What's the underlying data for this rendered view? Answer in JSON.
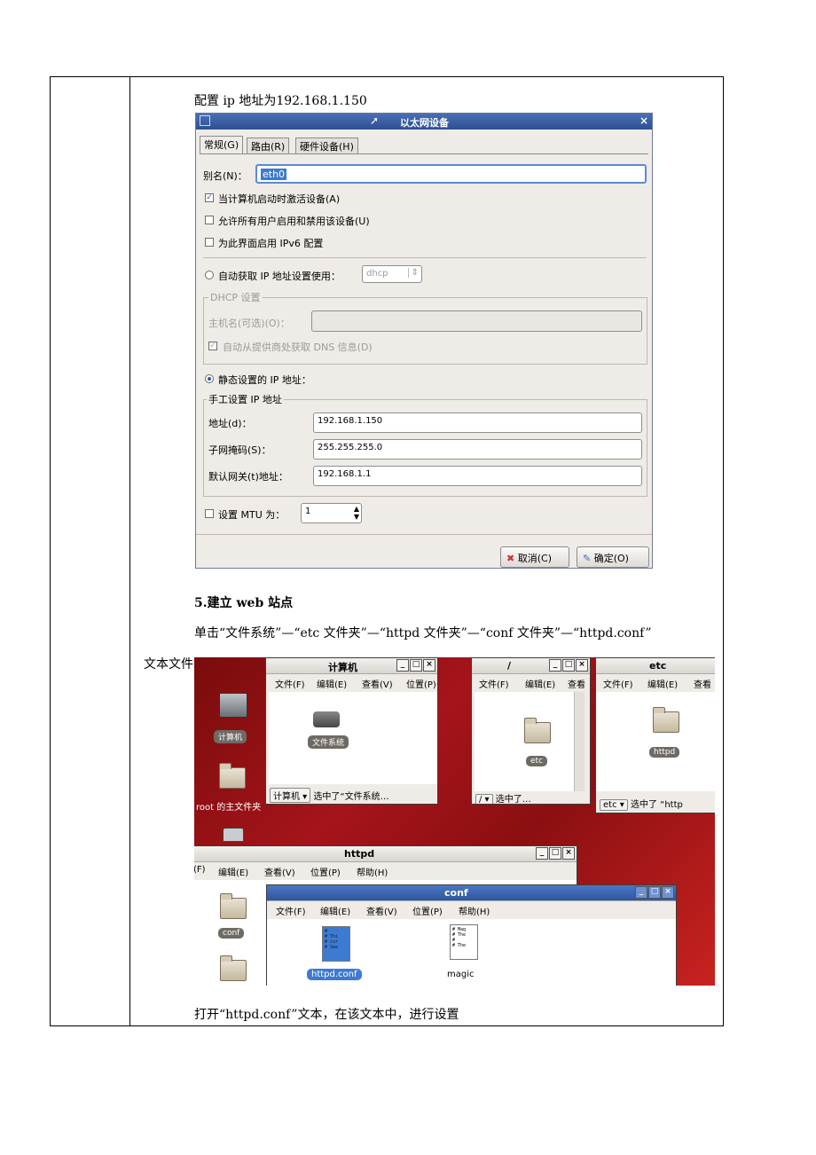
{
  "intro_text": "配置 ip 地址为192.168.1.150",
  "dialog": {
    "title": "以太网设备",
    "close": "×",
    "tabs": [
      "常规(G)",
      "路由(R)",
      "硬件设备(H)"
    ],
    "alias_label": "别名(N)：",
    "alias_value": "eth0",
    "cb_activate": "当计算机启动时激活设备(A)",
    "cb_allow_users": "允许所有用户启用和禁用该设备(U)",
    "cb_ipv6": "为此界面启用 IPv6 配置",
    "radio_auto": "自动获取 IP 地址设置使用：",
    "auto_method": "dhcp",
    "dhcp_group": "DHCP 设置",
    "hostname_label": "主机名(可选)(O)：",
    "dns_label": "自动从提供商处获取 DNS 信息(D)",
    "radio_static": "静态设置的 IP 地址：",
    "manual_group": "手工设置 IP 地址",
    "addr_label": "地址(d)：",
    "addr_value": "192.168.1.150",
    "mask_label": "子网掩码(S)：",
    "mask_value": "255.255.255.0",
    "gw_label": "默认网关(t)地址：",
    "gw_value": "192.168.1.1",
    "mtu_label": "设置 MTU 为：",
    "mtu_value": "1",
    "cancel": "取消(C)",
    "ok": "确定(O)"
  },
  "section_heading": "5.建立 web 站点",
  "para_1": "单击“文件系统”—“etc 文件夹”—“httpd 文件夹”—“conf 文件夹”—“httpd.conf”",
  "para_1_cont": "文本文件",
  "desktop": {
    "icon_computer": "计算机",
    "icon_home": "root 的主文件夹",
    "win_computer": {
      "title": "计算机",
      "menu": [
        "文件(F)",
        "编辑(E)",
        "查看(V)",
        "位置(P)",
        "书"
      ],
      "item": "文件系统",
      "location": "计算机 ▾",
      "status": "选中了“文件系统…"
    },
    "win_root": {
      "title": "/",
      "menu": [
        "文件(F)",
        "编辑(E)",
        "查看"
      ],
      "item": "etc",
      "location": "/ ▾",
      "status": "选中了…"
    },
    "win_etc": {
      "title": "etc",
      "menu": [
        "文件(F)",
        "编辑(E)",
        "查看"
      ],
      "item": "httpd",
      "location": "etc ▾",
      "status": "选中了 “http"
    },
    "win_httpd": {
      "title": "httpd",
      "menu": [
        "(F)",
        "编辑(E)",
        "查看(V)",
        "位置(P)",
        "帮助(H)"
      ],
      "item": "conf"
    },
    "win_conf": {
      "title": "conf",
      "menu": [
        "文件(F)",
        "编辑(E)",
        "查看(V)",
        "位置(P)",
        "帮助(H)"
      ],
      "file1": "httpd.conf",
      "file2": "magic",
      "file1_preview": "#\n# Thi\n# cor\n# See",
      "file2_preview": "# Mag\n# The\n#\n# The"
    }
  },
  "para_2": "打开“httpd.conf”文本，在该文本中，进行设置"
}
